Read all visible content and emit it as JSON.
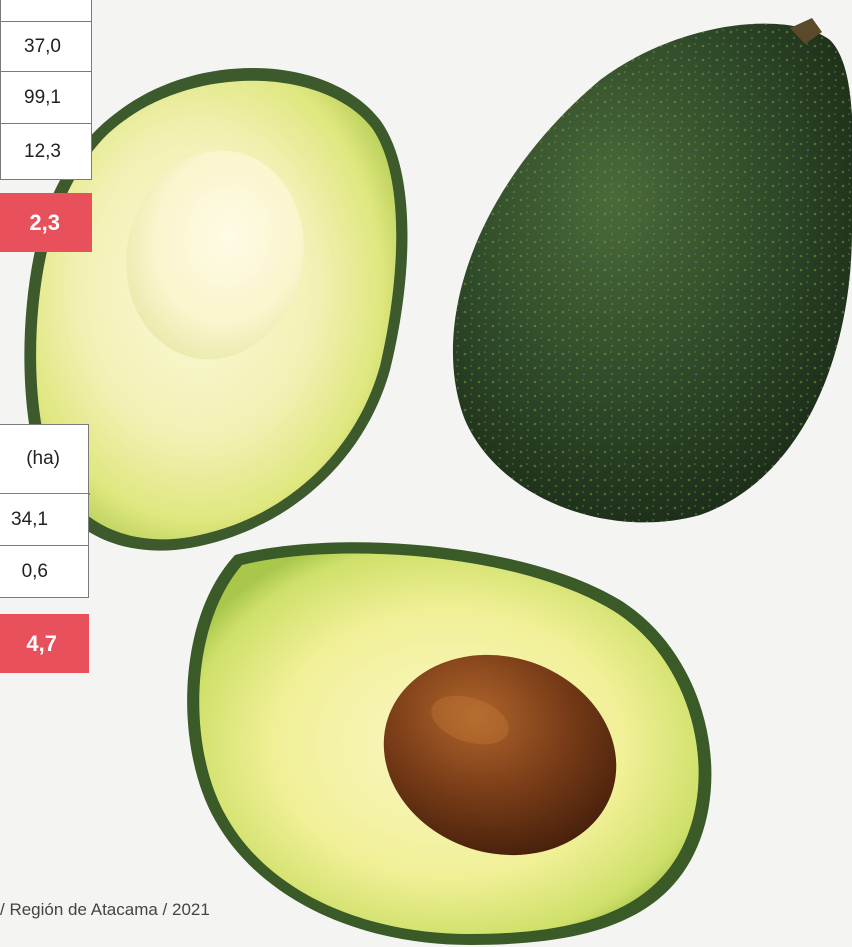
{
  "table_top": {
    "rows": [
      "37,0",
      "99,1",
      "12,3"
    ],
    "total": "2,3"
  },
  "table_bottom": {
    "header": "(ha)",
    "rows": [
      "34,1",
      "0,6"
    ],
    "total": "4,7"
  },
  "source": "/ Región de Atacama / 2021",
  "colors": {
    "accent": "#e8505b",
    "background": "#f4f5f3",
    "avocado_skin": "#2f4a2a",
    "avocado_flesh": "#e9ec9a",
    "avocado_pit": "#7a3d18"
  }
}
